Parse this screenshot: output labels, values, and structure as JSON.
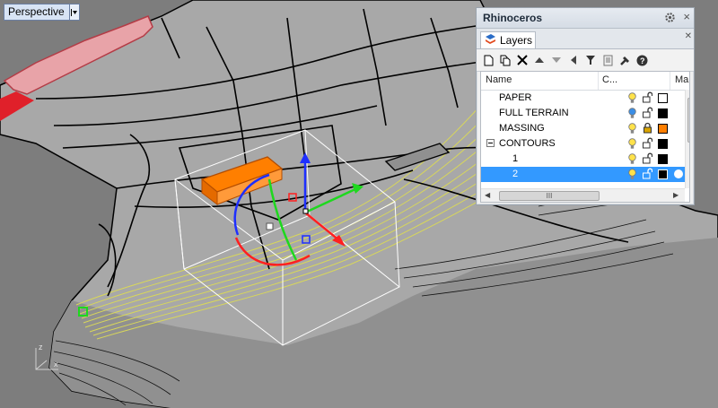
{
  "viewport": {
    "name": "Perspective",
    "axis_labels": {
      "z": "z",
      "x": "x"
    }
  },
  "panel": {
    "title": "Rhinoceros",
    "tab_label": "Layers",
    "toolbar_icons": [
      "new-layer-icon",
      "new-sublayer-icon",
      "delete-icon",
      "move-up-icon",
      "move-down-icon",
      "move-to-parent-icon",
      "filter-icon",
      "layer-states-icon",
      "tools-icon",
      "help-icon"
    ],
    "columns": {
      "name": "Name",
      "current": "C...",
      "material": "Ma"
    },
    "layers": [
      {
        "name": "PAPER",
        "indent": 0,
        "on": true,
        "locked": false,
        "color": "#ffffff",
        "selected": false,
        "expander": false
      },
      {
        "name": "FULL TERRAIN",
        "indent": 0,
        "on": true,
        "locked": false,
        "color": "#000000",
        "selected": false,
        "expander": false
      },
      {
        "name": "MASSING",
        "indent": 0,
        "on": true,
        "locked": true,
        "color": "#ff7f00",
        "selected": false,
        "expander": false
      },
      {
        "name": "CONTOURS",
        "indent": 0,
        "on": true,
        "locked": false,
        "color": "#000000",
        "selected": false,
        "expander": true
      },
      {
        "name": "1",
        "indent": 1,
        "on": true,
        "locked": false,
        "color": "#000000",
        "selected": false,
        "expander": false
      },
      {
        "name": "2",
        "indent": 1,
        "on": true,
        "locked": false,
        "color": "#000000",
        "selected": true,
        "expander": false
      }
    ],
    "hscroll_glyph": "III"
  }
}
